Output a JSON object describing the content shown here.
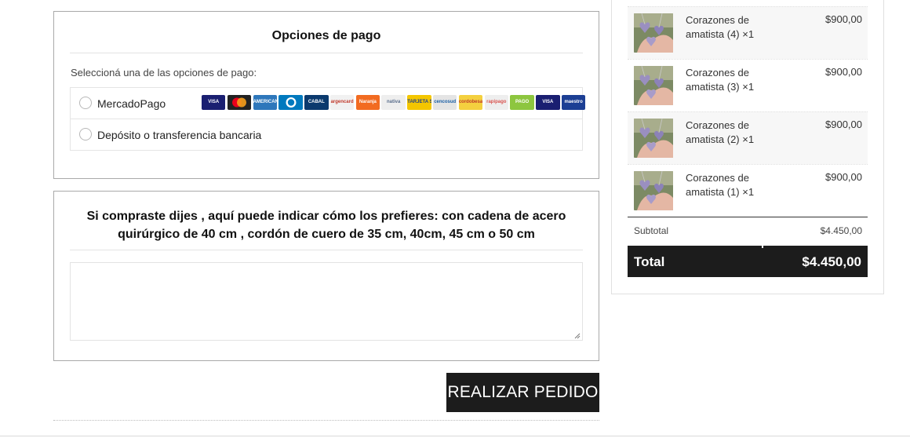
{
  "payment": {
    "title": "Opciones de pago",
    "instruction": "Seleccioná una de las opciones de pago:",
    "methods": [
      {
        "label": "MercadoPago",
        "selected": false
      },
      {
        "label": "Depósito o transferencia bancaria",
        "selected": false
      }
    ],
    "card_logos": [
      {
        "name": "visa-logo",
        "text": "VISA",
        "bg": "#1a1f71",
        "fg": "#ffffff"
      },
      {
        "name": "mastercard-logo",
        "text": "",
        "bg": "#222222",
        "fg": "#ffffff"
      },
      {
        "name": "american-express-logo",
        "text": "AMERICAN EXPRESS",
        "bg": "#2e77bb",
        "fg": "#ffffff"
      },
      {
        "name": "diners-club-logo",
        "text": "",
        "bg": "#0079be",
        "fg": "#ffffff"
      },
      {
        "name": "cabal-logo",
        "text": "CABAL",
        "bg": "#0b3a6e",
        "fg": "#ffffff"
      },
      {
        "name": "argencard-logo",
        "text": "argencard",
        "bg": "#f1f1f1",
        "fg": "#c0392b"
      },
      {
        "name": "naranja-logo",
        "text": "Naranja",
        "bg": "#f26b21",
        "fg": "#ffffff"
      },
      {
        "name": "nativa-logo",
        "text": "nativa",
        "bg": "#eeeeee",
        "fg": "#5a6e8c"
      },
      {
        "name": "tarjeta-shopping-logo",
        "text": "TARJETA SHOPPING",
        "bg": "#f4c600",
        "fg": "#1a3d8f"
      },
      {
        "name": "cencosud-logo",
        "text": "cencosud",
        "bg": "#e4e4e4",
        "fg": "#1a5fa6"
      },
      {
        "name": "cordobesa-logo",
        "text": "cordobesa",
        "bg": "#f4d03f",
        "fg": "#c0392b"
      },
      {
        "name": "rapipago-logo",
        "text": "rapipago",
        "bg": "#eeeeee",
        "fg": "#d9534f"
      },
      {
        "name": "pagofacil-logo",
        "text": "PAGO",
        "bg": "#8dc63f",
        "fg": "#ffffff"
      },
      {
        "name": "visa-debit-logo",
        "text": "VISA",
        "bg": "#1a1f71",
        "fg": "#ffffff"
      },
      {
        "name": "maestro-logo",
        "text": "maestro",
        "bg": "#1c3f94",
        "fg": "#ffffff"
      }
    ]
  },
  "notes": {
    "title": "Si compraste dijes , aquí puede indicar cómo los prefieres: con cadena de acero quirúrgico de 40 cm , cordón de cuero de 35 cm, 40cm, 45 cm o 50 cm",
    "value": ""
  },
  "place_order_label": "REALIZAR PEDIDO",
  "order_summary": {
    "items": [
      {
        "name": "Corazones de amatista (4)",
        "qty": "×1",
        "price": "$900,00"
      },
      {
        "name": "Corazones de amatista (3)",
        "qty": "×1",
        "price": "$900,00"
      },
      {
        "name": "Corazones de amatista (2)",
        "qty": "×1",
        "price": "$900,00"
      },
      {
        "name": "Corazones de amatista (1)",
        "qty": "×1",
        "price": "$900,00"
      }
    ],
    "subtotal_label": "Subtotal",
    "subtotal_value": "$4.450,00",
    "total_label": "Total",
    "total_value": "$4.450,00"
  },
  "colors": {
    "dark_button": "#1c1c1c",
    "border": "#a9a9a9"
  }
}
